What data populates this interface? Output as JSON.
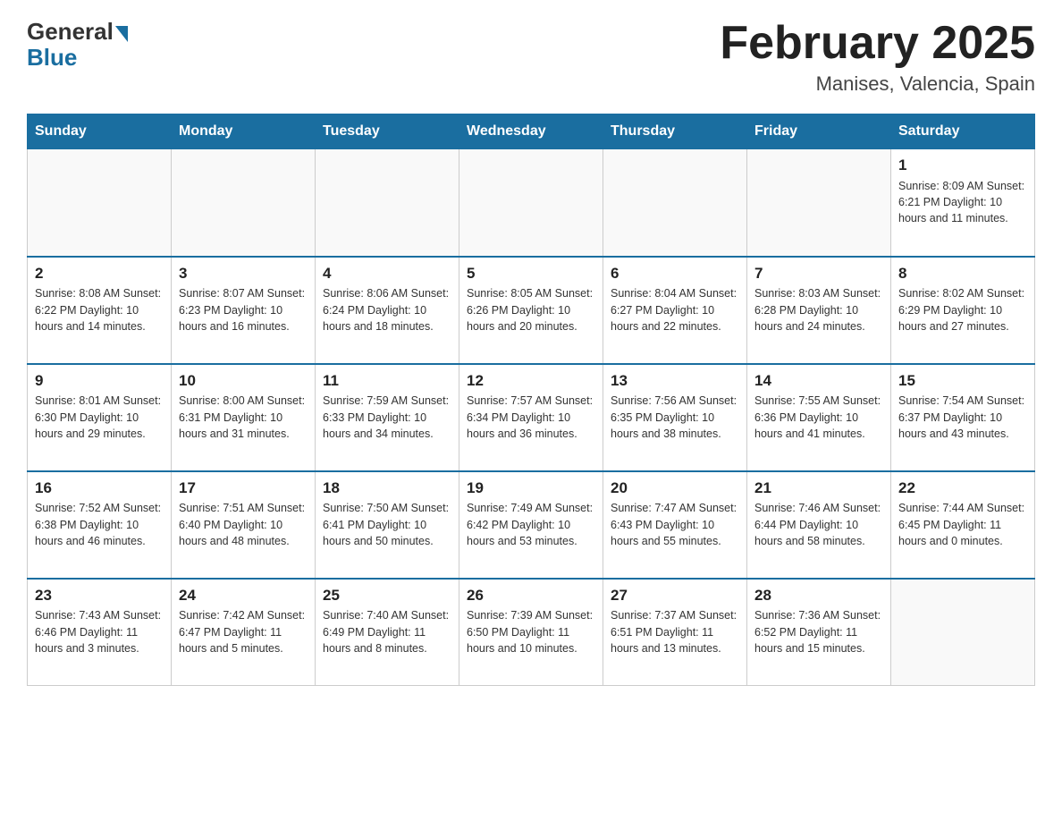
{
  "header": {
    "logo_general": "General",
    "logo_blue": "Blue",
    "month_title": "February 2025",
    "location": "Manises, Valencia, Spain"
  },
  "days_of_week": [
    "Sunday",
    "Monday",
    "Tuesday",
    "Wednesday",
    "Thursday",
    "Friday",
    "Saturday"
  ],
  "weeks": [
    [
      {
        "day": "",
        "info": ""
      },
      {
        "day": "",
        "info": ""
      },
      {
        "day": "",
        "info": ""
      },
      {
        "day": "",
        "info": ""
      },
      {
        "day": "",
        "info": ""
      },
      {
        "day": "",
        "info": ""
      },
      {
        "day": "1",
        "info": "Sunrise: 8:09 AM\nSunset: 6:21 PM\nDaylight: 10 hours and 11 minutes."
      }
    ],
    [
      {
        "day": "2",
        "info": "Sunrise: 8:08 AM\nSunset: 6:22 PM\nDaylight: 10 hours and 14 minutes."
      },
      {
        "day": "3",
        "info": "Sunrise: 8:07 AM\nSunset: 6:23 PM\nDaylight: 10 hours and 16 minutes."
      },
      {
        "day": "4",
        "info": "Sunrise: 8:06 AM\nSunset: 6:24 PM\nDaylight: 10 hours and 18 minutes."
      },
      {
        "day": "5",
        "info": "Sunrise: 8:05 AM\nSunset: 6:26 PM\nDaylight: 10 hours and 20 minutes."
      },
      {
        "day": "6",
        "info": "Sunrise: 8:04 AM\nSunset: 6:27 PM\nDaylight: 10 hours and 22 minutes."
      },
      {
        "day": "7",
        "info": "Sunrise: 8:03 AM\nSunset: 6:28 PM\nDaylight: 10 hours and 24 minutes."
      },
      {
        "day": "8",
        "info": "Sunrise: 8:02 AM\nSunset: 6:29 PM\nDaylight: 10 hours and 27 minutes."
      }
    ],
    [
      {
        "day": "9",
        "info": "Sunrise: 8:01 AM\nSunset: 6:30 PM\nDaylight: 10 hours and 29 minutes."
      },
      {
        "day": "10",
        "info": "Sunrise: 8:00 AM\nSunset: 6:31 PM\nDaylight: 10 hours and 31 minutes."
      },
      {
        "day": "11",
        "info": "Sunrise: 7:59 AM\nSunset: 6:33 PM\nDaylight: 10 hours and 34 minutes."
      },
      {
        "day": "12",
        "info": "Sunrise: 7:57 AM\nSunset: 6:34 PM\nDaylight: 10 hours and 36 minutes."
      },
      {
        "day": "13",
        "info": "Sunrise: 7:56 AM\nSunset: 6:35 PM\nDaylight: 10 hours and 38 minutes."
      },
      {
        "day": "14",
        "info": "Sunrise: 7:55 AM\nSunset: 6:36 PM\nDaylight: 10 hours and 41 minutes."
      },
      {
        "day": "15",
        "info": "Sunrise: 7:54 AM\nSunset: 6:37 PM\nDaylight: 10 hours and 43 minutes."
      }
    ],
    [
      {
        "day": "16",
        "info": "Sunrise: 7:52 AM\nSunset: 6:38 PM\nDaylight: 10 hours and 46 minutes."
      },
      {
        "day": "17",
        "info": "Sunrise: 7:51 AM\nSunset: 6:40 PM\nDaylight: 10 hours and 48 minutes."
      },
      {
        "day": "18",
        "info": "Sunrise: 7:50 AM\nSunset: 6:41 PM\nDaylight: 10 hours and 50 minutes."
      },
      {
        "day": "19",
        "info": "Sunrise: 7:49 AM\nSunset: 6:42 PM\nDaylight: 10 hours and 53 minutes."
      },
      {
        "day": "20",
        "info": "Sunrise: 7:47 AM\nSunset: 6:43 PM\nDaylight: 10 hours and 55 minutes."
      },
      {
        "day": "21",
        "info": "Sunrise: 7:46 AM\nSunset: 6:44 PM\nDaylight: 10 hours and 58 minutes."
      },
      {
        "day": "22",
        "info": "Sunrise: 7:44 AM\nSunset: 6:45 PM\nDaylight: 11 hours and 0 minutes."
      }
    ],
    [
      {
        "day": "23",
        "info": "Sunrise: 7:43 AM\nSunset: 6:46 PM\nDaylight: 11 hours and 3 minutes."
      },
      {
        "day": "24",
        "info": "Sunrise: 7:42 AM\nSunset: 6:47 PM\nDaylight: 11 hours and 5 minutes."
      },
      {
        "day": "25",
        "info": "Sunrise: 7:40 AM\nSunset: 6:49 PM\nDaylight: 11 hours and 8 minutes."
      },
      {
        "day": "26",
        "info": "Sunrise: 7:39 AM\nSunset: 6:50 PM\nDaylight: 11 hours and 10 minutes."
      },
      {
        "day": "27",
        "info": "Sunrise: 7:37 AM\nSunset: 6:51 PM\nDaylight: 11 hours and 13 minutes."
      },
      {
        "day": "28",
        "info": "Sunrise: 7:36 AM\nSunset: 6:52 PM\nDaylight: 11 hours and 15 minutes."
      },
      {
        "day": "",
        "info": ""
      }
    ]
  ]
}
